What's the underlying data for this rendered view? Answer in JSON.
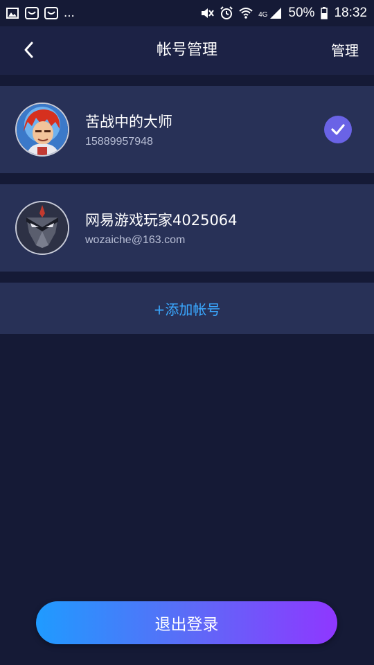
{
  "status_bar": {
    "left_icons": [
      "image-icon",
      "notification-app-icon",
      "notification-app-icon"
    ],
    "more": "...",
    "right_icons": [
      "mute-icon",
      "alarm-icon",
      "wifi-icon",
      "signal-4g-icon",
      "battery-icon"
    ],
    "network": "4G",
    "battery": "50%",
    "time": "18:32"
  },
  "header": {
    "back_icon": "chevron-left-icon",
    "title": "帐号管理",
    "manage_label": "管理"
  },
  "accounts": [
    {
      "name": "苦战中的大师",
      "id": "15889957948",
      "avatar": "hero-avatar",
      "selected": true
    },
    {
      "name": "网易游戏玩家4025064",
      "id": "wozaiche@163.com",
      "avatar": "ninja-mask-avatar",
      "selected": false
    }
  ],
  "add_account_label": "+添加帐号",
  "logout_label": "退出登录",
  "colors": {
    "background": "#151a36",
    "header": "#1c2245",
    "card": "#283157",
    "accent_blue": "#3aa8ff",
    "check": "#6a63e6",
    "gradient_start": "#1f9bff",
    "gradient_end": "#8f37ff"
  }
}
